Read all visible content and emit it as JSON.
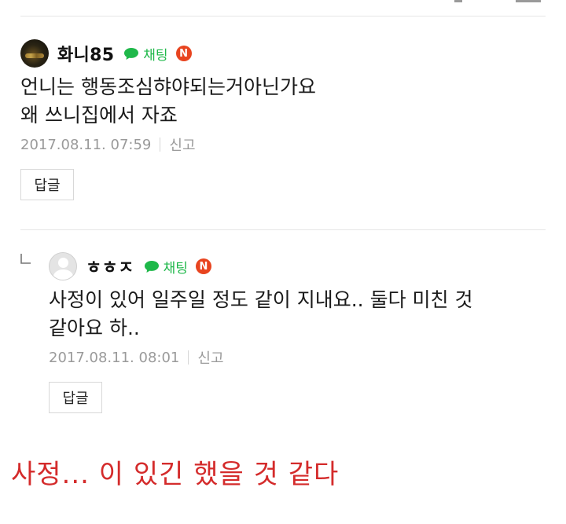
{
  "comments": [
    {
      "nickname": "화니85",
      "chat_label": "채팅",
      "n_badge": "N",
      "body_lines": [
        "언니는 행동조심햐야되는거아닌가요",
        "왜 쓰니집에서 자죠"
      ],
      "timestamp": "2017.08.11. 07:59",
      "report_label": "신고",
      "reply_label": "답글"
    },
    {
      "nickname": "ㅎㅎㅈ",
      "chat_label": "채팅",
      "n_badge": "N",
      "body_lines": [
        "사정이 있어 일주일 정도 같이 지내요.. 둘다 미친 것",
        "같아요 하.."
      ],
      "timestamp": "2017.08.11. 08:01",
      "report_label": "신고",
      "reply_label": "답글"
    }
  ],
  "caption": "사정... 이 있긴 했을 것 같다",
  "colors": {
    "chat_green": "#1fb84a",
    "n_badge_red": "#e8441f",
    "caption_red": "#d42b2b",
    "meta_grey": "#9a9a9a"
  },
  "icons": [
    "chat-bubble-icon",
    "naver-n-icon",
    "reply-arrow-icon"
  ]
}
